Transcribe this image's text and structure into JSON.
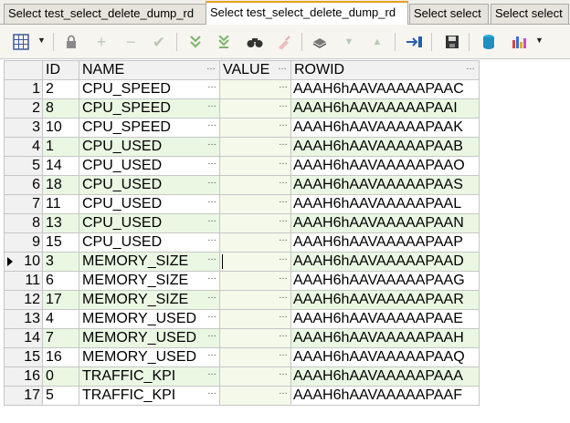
{
  "tabs": [
    {
      "label": "Select test_select_delete_dump_rd",
      "active": false
    },
    {
      "label": "Select test_select_delete_dump_rd",
      "active": true
    },
    {
      "label": "Select select",
      "active": false
    },
    {
      "label": "Select select",
      "active": false
    }
  ],
  "toolbar": {
    "icons": [
      "grid-view-icon",
      "dropdown-caret-icon",
      "lock-icon",
      "add-record-icon",
      "delete-record-icon",
      "post-edit-icon",
      "next-record-icon",
      "last-record-icon",
      "find-icon",
      "clear-icon",
      "print-icon",
      "filter-down-icon",
      "filter-up-icon",
      "export-icon",
      "save-icon",
      "database-icon",
      "chart-icon"
    ]
  },
  "grid": {
    "columns": [
      "ID",
      "NAME",
      "VALUE",
      "ROWID"
    ],
    "current_row": 10,
    "rows": [
      {
        "n": "1",
        "id": "2",
        "name": "CPU_SPEED",
        "value": "",
        "rowid": "AAAH6hAAVAAAAAPAAC"
      },
      {
        "n": "2",
        "id": "8",
        "name": "CPU_SPEED",
        "value": "",
        "rowid": "AAAH6hAAVAAAAAPAAI"
      },
      {
        "n": "3",
        "id": "10",
        "name": "CPU_SPEED",
        "value": "",
        "rowid": "AAAH6hAAVAAAAAPAAK"
      },
      {
        "n": "4",
        "id": "1",
        "name": "CPU_USED",
        "value": "",
        "rowid": "AAAH6hAAVAAAAAPAAB"
      },
      {
        "n": "5",
        "id": "14",
        "name": "CPU_USED",
        "value": "",
        "rowid": "AAAH6hAAVAAAAAPAAO"
      },
      {
        "n": "6",
        "id": "18",
        "name": "CPU_USED",
        "value": "",
        "rowid": "AAAH6hAAVAAAAAPAAS"
      },
      {
        "n": "7",
        "id": "11",
        "name": "CPU_USED",
        "value": "",
        "rowid": "AAAH6hAAVAAAAAPAAL"
      },
      {
        "n": "8",
        "id": "13",
        "name": "CPU_USED",
        "value": "",
        "rowid": "AAAH6hAAVAAAAAPAAN"
      },
      {
        "n": "9",
        "id": "15",
        "name": "CPU_USED",
        "value": "",
        "rowid": "AAAH6hAAVAAAAAPAAP"
      },
      {
        "n": "10",
        "id": "3",
        "name": "MEMORY_SIZE",
        "value": "",
        "rowid": "AAAH6hAAVAAAAAPAAD"
      },
      {
        "n": "11",
        "id": "6",
        "name": "MEMORY_SIZE",
        "value": "",
        "rowid": "AAAH6hAAVAAAAAPAAG"
      },
      {
        "n": "12",
        "id": "17",
        "name": "MEMORY_SIZE",
        "value": "",
        "rowid": "AAAH6hAAVAAAAAPAAR"
      },
      {
        "n": "13",
        "id": "4",
        "name": "MEMORY_USED",
        "value": "",
        "rowid": "AAAH6hAAVAAAAAPAAE"
      },
      {
        "n": "14",
        "id": "7",
        "name": "MEMORY_USED",
        "value": "",
        "rowid": "AAAH6hAAVAAAAAPAAH"
      },
      {
        "n": "15",
        "id": "16",
        "name": "MEMORY_USED",
        "value": "",
        "rowid": "AAAH6hAAVAAAAAPAAQ"
      },
      {
        "n": "16",
        "id": "0",
        "name": "TRAFFIC_KPI",
        "value": "",
        "rowid": "AAAH6hAAVAAAAAPAAA"
      },
      {
        "n": "17",
        "id": "5",
        "name": "TRAFFIC_KPI",
        "value": "",
        "rowid": "AAAH6hAAVAAAAAPAAF"
      }
    ],
    "ellipsis": "…"
  }
}
